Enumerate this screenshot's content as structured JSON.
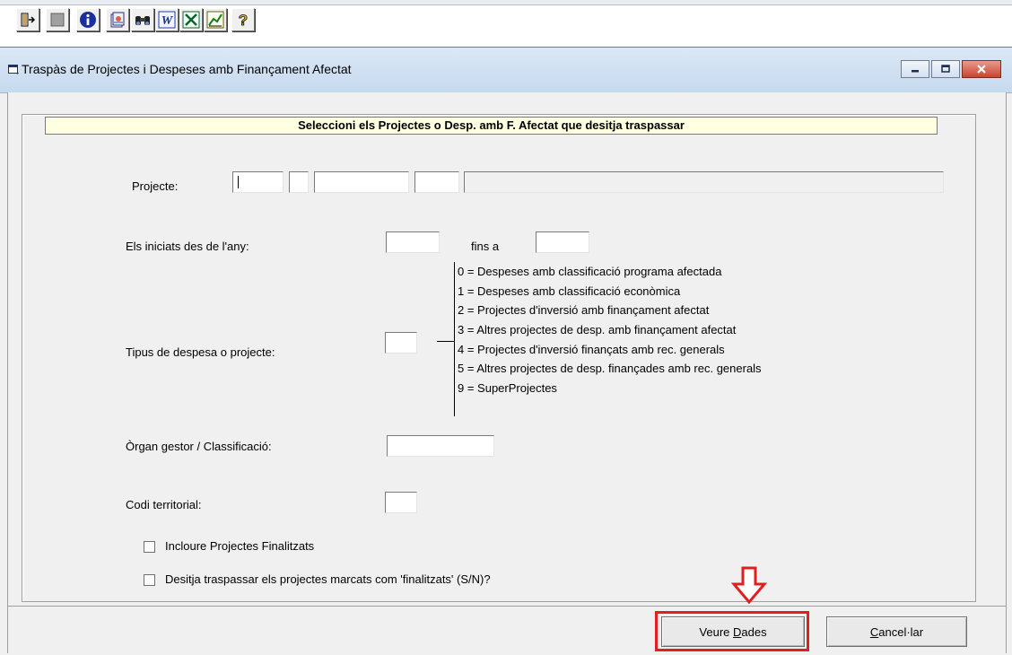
{
  "toolbar": {
    "buttons": [
      {
        "icon": "exit-icon"
      },
      {
        "icon": "stop-icon"
      },
      {
        "icon": "info-icon"
      },
      {
        "icon": "document-icon"
      },
      {
        "icon": "binoculars-icon"
      },
      {
        "icon": "word-icon"
      },
      {
        "icon": "excel-icon"
      },
      {
        "icon": "chart-icon"
      },
      {
        "icon": "help-icon"
      }
    ]
  },
  "window": {
    "title": "Traspàs de Projectes i Despeses amb Finançament Afectat"
  },
  "form": {
    "banner": "Seleccioni els Projectes o Desp. amb F. Afectat que desitja traspassar",
    "projecte_label": "Projecte:",
    "iniciats_label": "Els iniciats des de l'any:",
    "fins_a_label": "fins a",
    "tipus_label": "Tipus de despesa o projecte:",
    "tipus_options": [
      "0 = Despeses amb classificació programa afectada",
      "1 = Despeses amb classificació econòmica",
      "2 = Projectes d'inversió amb finançament afectat",
      "3 = Altres projectes de desp. amb finançament afectat",
      "4 = Projectes d'inversió finançats amb rec. generals",
      "5 = Altres projectes de desp. finançades amb rec. generals",
      "9 = SuperProjectes"
    ],
    "organ_label": "Òrgan gestor / Classificació:",
    "codi_label": "Codi territorial:",
    "incloure_label": "Incloure Projectes Finalitzats",
    "traspassar_label": "Desitja traspassar els projectes marcats com 'finalitzats' (S/N)?"
  },
  "buttons": {
    "veure_prefix": "Veure ",
    "veure_mnemonic": "D",
    "veure_suffix": "ades",
    "cancel_mnemonic": "C",
    "cancel_suffix": "ancel·lar"
  },
  "colors": {
    "banner_bg": "#ffffe1",
    "highlight": "#e02020"
  }
}
